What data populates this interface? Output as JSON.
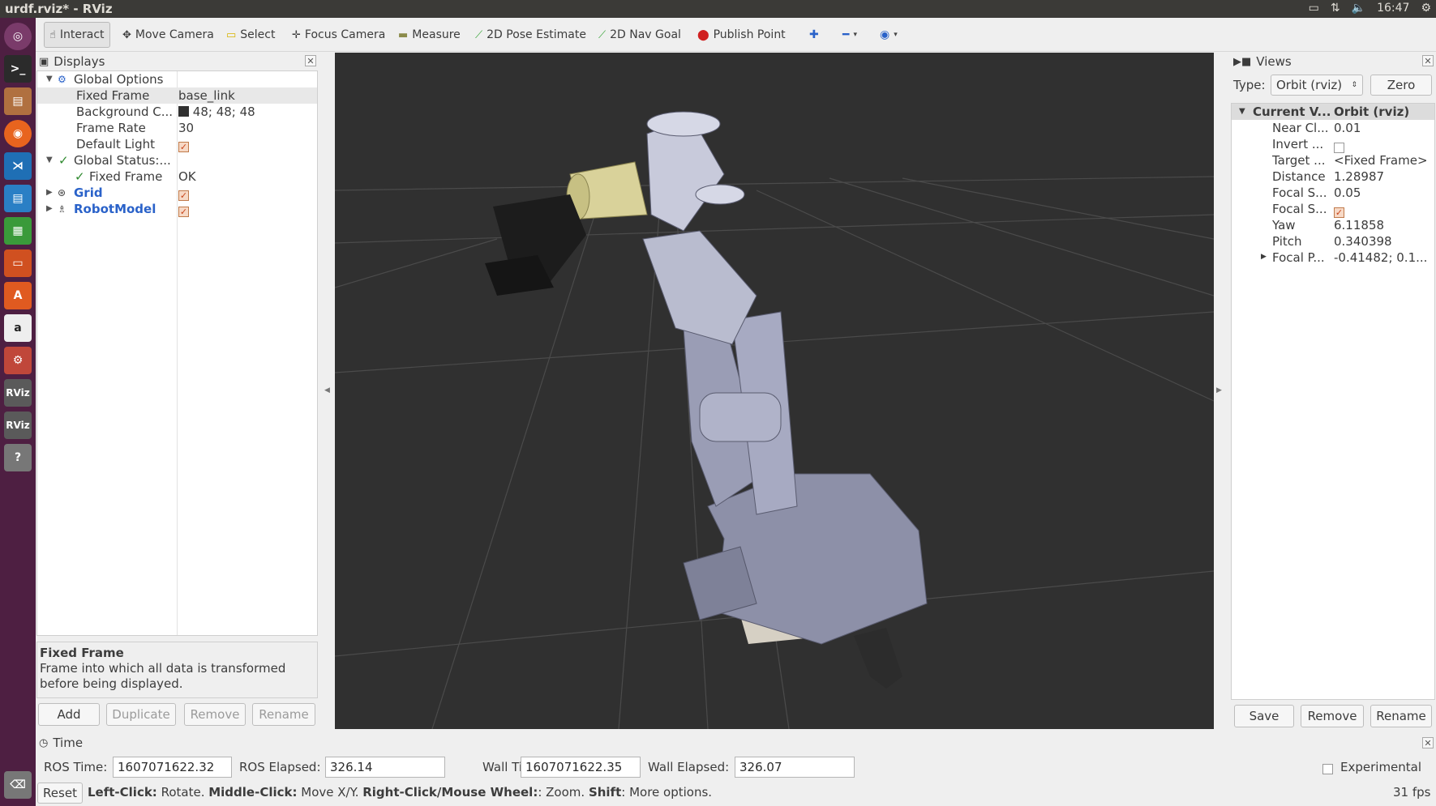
{
  "window": {
    "title": "urdf.rviz* - RViz"
  },
  "tray": {
    "keyboard": "kbd-icon",
    "network": "⇅",
    "volume": "🔈",
    "clock": "16:47",
    "settings": "gear-icon"
  },
  "toolbar": {
    "interact": "Interact",
    "move_camera": "Move Camera",
    "select": "Select",
    "focus_camera": "Focus Camera",
    "measure": "Measure",
    "pose_estimate": "2D Pose Estimate",
    "nav_goal": "2D Nav Goal",
    "publish_point": "Publish Point"
  },
  "displays": {
    "title": "Displays",
    "global_options": "Global Options",
    "fixed_frame_label": "Fixed Frame",
    "fixed_frame_value": "base_link",
    "background_label": "Background C...",
    "background_value": "48; 48; 48",
    "frame_rate_label": "Frame Rate",
    "frame_rate_value": "30",
    "default_light_label": "Default Light",
    "global_status": "Global Status:...",
    "status_fixed_frame": "Fixed Frame",
    "status_ok": "OK",
    "grid": "Grid",
    "robot_model": "RobotModel",
    "desc_title": "Fixed Frame",
    "desc_text": "Frame into which all data is transformed before being displayed.",
    "add": "Add",
    "duplicate": "Duplicate",
    "remove": "Remove",
    "rename": "Rename"
  },
  "views": {
    "title": "Views",
    "type_label": "Type:",
    "type_value": "Orbit (rviz)",
    "zero": "Zero",
    "current_label": "Current V...",
    "current_value": "Orbit (rviz)",
    "rows": [
      {
        "label": "Near Cl...",
        "value": "0.01"
      },
      {
        "label": "Invert ...",
        "value": ""
      },
      {
        "label": "Target ...",
        "value": "<Fixed Frame>"
      },
      {
        "label": "Distance",
        "value": "1.28987"
      },
      {
        "label": "Focal S...",
        "value": "0.05"
      },
      {
        "label": "Focal S...",
        "value": ""
      },
      {
        "label": "Yaw",
        "value": "6.11858"
      },
      {
        "label": "Pitch",
        "value": "0.340398"
      },
      {
        "label": "Focal P...",
        "value": "-0.41482; 0.1..."
      }
    ],
    "save": "Save",
    "remove": "Remove",
    "rename": "Rename"
  },
  "time": {
    "title": "Time",
    "ros_time_label": "ROS Time:",
    "ros_time": "1607071622.32",
    "ros_elapsed_label": "ROS Elapsed:",
    "ros_elapsed": "326.14",
    "wall_time_label": "Wall Time:",
    "wall_time": "1607071622.35",
    "wall_elapsed_label": "Wall Elapsed:",
    "wall_elapsed": "326.07",
    "experimental": "Experimental"
  },
  "status": {
    "reset": "Reset",
    "left_click": "Left-Click:",
    "left_text": " Rotate. ",
    "middle_click": "Middle-Click:",
    "middle_text": " Move X/Y. ",
    "right_click": "Right-Click/Mouse Wheel:",
    "right_text": ": Zoom. ",
    "shift": "Shift",
    "shift_text": ": More options.",
    "fps": "31 fps"
  },
  "colors": {
    "launcher": "#4e1f42",
    "viewport": "#303030",
    "robot": "#9a9db5",
    "gripper_yellow": "#d9d29a"
  }
}
